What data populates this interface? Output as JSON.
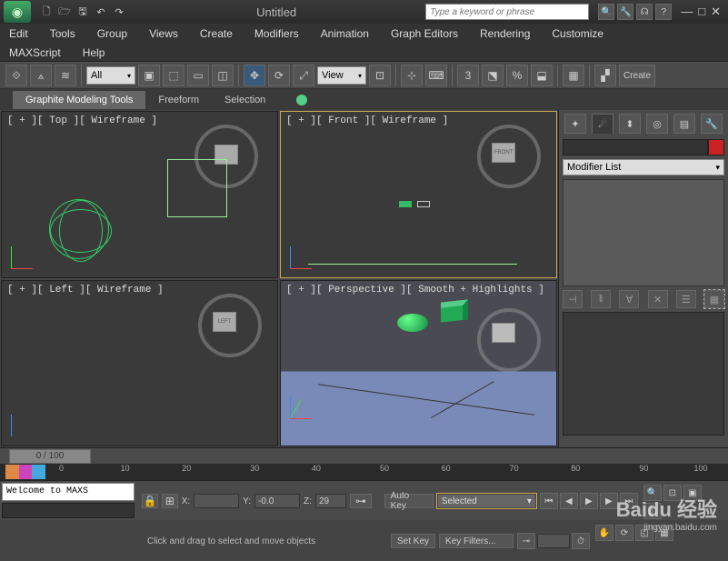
{
  "title": "Untitled",
  "search_placeholder": "Type a keyword or phrase",
  "menu": [
    "Edit",
    "Tools",
    "Group",
    "Views",
    "Create",
    "Modifiers",
    "Animation",
    "Graph Editors",
    "Rendering",
    "Customize"
  ],
  "menu2": [
    "MAXScript",
    "Help"
  ],
  "toolbar": {
    "filter": "All",
    "refsys": "View",
    "create_label": "Create"
  },
  "ribbon": {
    "tabs": [
      "Graphite Modeling Tools",
      "Freeform",
      "Selection"
    ]
  },
  "viewports": {
    "top": "[ + ][ Top ][ Wireframe ]",
    "front": "[ + ][ Front ][ Wireframe ]",
    "left": "[ + ][ Left ][ Wireframe ]",
    "persp": "[ + ][ Perspective ][ Smooth + Highlights ]",
    "front_tag": "FRONT",
    "left_tag": "LEFT"
  },
  "sidebar": {
    "modifier_list": "Modifier List"
  },
  "timeline": {
    "slider": "0 / 100",
    "ticks": [
      "0",
      "10",
      "20",
      "30",
      "40",
      "50",
      "60",
      "70",
      "80",
      "90",
      "100"
    ]
  },
  "status": {
    "prompt": "Welcome to MAXS",
    "hint": "Click and drag to select and move objects",
    "x_label": "X:",
    "y_label": "Y:",
    "z_label": "Z:",
    "x": "",
    "y": "-0.0",
    "z": "29",
    "autokey": "Auto Key",
    "setkey": "Set Key",
    "selected": "Selected",
    "keyfilters": "Key Filters..."
  },
  "watermark": {
    "brand": "Baidu 经验",
    "url": "jingyan.baidu.com"
  }
}
